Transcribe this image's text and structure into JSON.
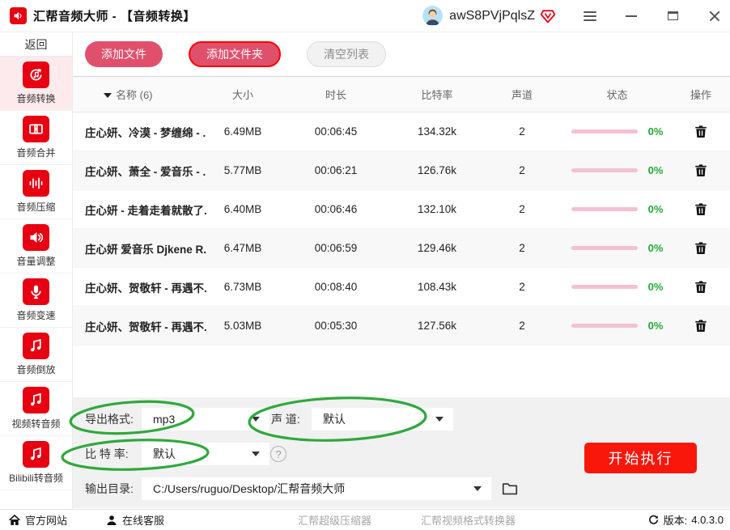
{
  "title_bar": {
    "app_title": "汇帮音频大师 - 【音频转换】",
    "username": "awS8PVjPqlsZ"
  },
  "sidebar": {
    "back": "返回",
    "items": [
      {
        "label": "音频转换",
        "icon": "audio-convert",
        "active": true
      },
      {
        "label": "音频合并",
        "icon": "audio-merge",
        "active": false
      },
      {
        "label": "音频压缩",
        "icon": "audio-compress",
        "active": false
      },
      {
        "label": "音量调整",
        "icon": "volume-adjust",
        "active": false
      },
      {
        "label": "音频变速",
        "icon": "audio-speed",
        "active": false
      },
      {
        "label": "音频倒放",
        "icon": "audio-reverse",
        "active": false
      },
      {
        "label": "视频转音频",
        "icon": "video-to-audio",
        "active": false
      },
      {
        "label": "Bilibili转音频",
        "icon": "bilibili-to-audio",
        "active": false
      }
    ]
  },
  "toolbar": {
    "add_file": "添加文件",
    "add_folder": "添加文件夹",
    "clear_list": "清空列表"
  },
  "table": {
    "columns": {
      "name": "名称 (6)",
      "size": "大小",
      "duration": "时长",
      "bitrate": "比特率",
      "channels": "声道",
      "status": "状态",
      "action": "操作"
    },
    "rows": [
      {
        "name": "庄心妍、冷漠 - 梦缠绵 - ...",
        "size": "6.49MB",
        "duration": "00:06:45",
        "bitrate": "134.32k",
        "channels": "2",
        "progress": "0%"
      },
      {
        "name": "庄心妍、萧全 - 爱音乐 - ...",
        "size": "5.77MB",
        "duration": "00:06:21",
        "bitrate": "126.76k",
        "channels": "2",
        "progress": "0%"
      },
      {
        "name": "庄心妍 - 走着走着就散了...",
        "size": "6.40MB",
        "duration": "00:06:46",
        "bitrate": "132.10k",
        "channels": "2",
        "progress": "0%"
      },
      {
        "name": "庄心妍 爱音乐 Djkene R...",
        "size": "6.47MB",
        "duration": "00:06:59",
        "bitrate": "129.46k",
        "channels": "2",
        "progress": "0%"
      },
      {
        "name": "庄心妍、贺敬轩 - 再遇不...",
        "size": "6.73MB",
        "duration": "00:08:40",
        "bitrate": "108.43k",
        "channels": "2",
        "progress": "0%"
      },
      {
        "name": "庄心妍、贺敬轩 - 再遇不...",
        "size": "5.03MB",
        "duration": "00:05:30",
        "bitrate": "127.56k",
        "channels": "2",
        "progress": "0%"
      }
    ]
  },
  "settings": {
    "export_label": "导出格式:",
    "export_value": "mp3",
    "channel_label": "声 道:",
    "channel_value": "默认",
    "bitrate_label": "比 特 率:",
    "bitrate_value": "默认",
    "output_label": "输出目录:",
    "output_value": "C:/Users/ruguo/Desktop/汇帮音频大师",
    "help_glyph": "?",
    "start": "开始执行"
  },
  "footer": {
    "official_site": "官方网站",
    "online_service": "在线客服",
    "link_compressor": "汇帮超级压缩器",
    "link_video_converter": "汇帮视频格式转换器",
    "version_label": "版本:",
    "version": "4.0.3.0"
  },
  "colors": {
    "brand_red": "#e60012",
    "rose_button": "#e0506c",
    "start_red": "#f9170c",
    "progress_pink": "#f3c1d0",
    "percent_green": "#21a937",
    "annotation_green": "#2fa83c"
  }
}
